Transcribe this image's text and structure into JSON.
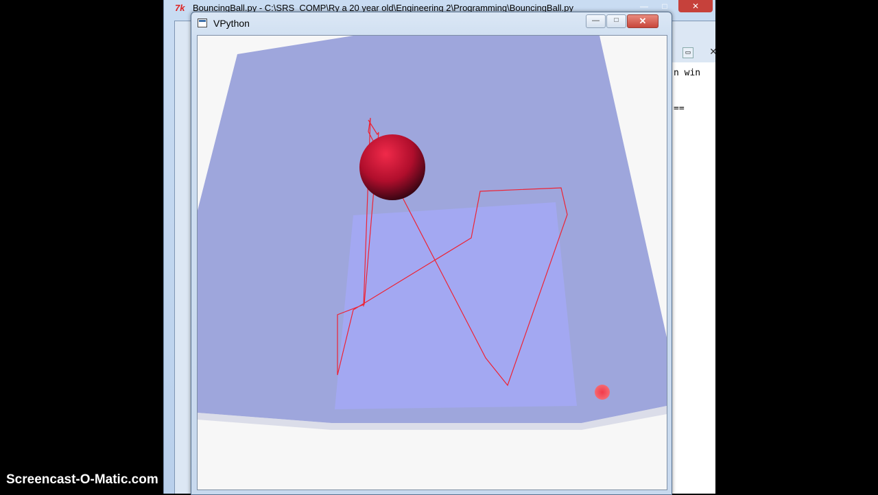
{
  "background_window": {
    "title": "BouncingBall.py - C:\\SRS_COMP\\Ry a 20 year old\\Engineering 2\\Programming\\BouncingBall.py",
    "editor_text_line1": "n win",
    "editor_text_line2": "=="
  },
  "vpython_window": {
    "title": "VPython",
    "min_label": "—",
    "max_label": "□",
    "close_label": "✕"
  },
  "scene": {
    "box_color": "#9ea6dc",
    "back_wall_color": "#a3a8f2",
    "ball_color": "#cc1133",
    "trail_color": "#ee2233"
  },
  "watermark": "Screencast-O-Matic.com"
}
